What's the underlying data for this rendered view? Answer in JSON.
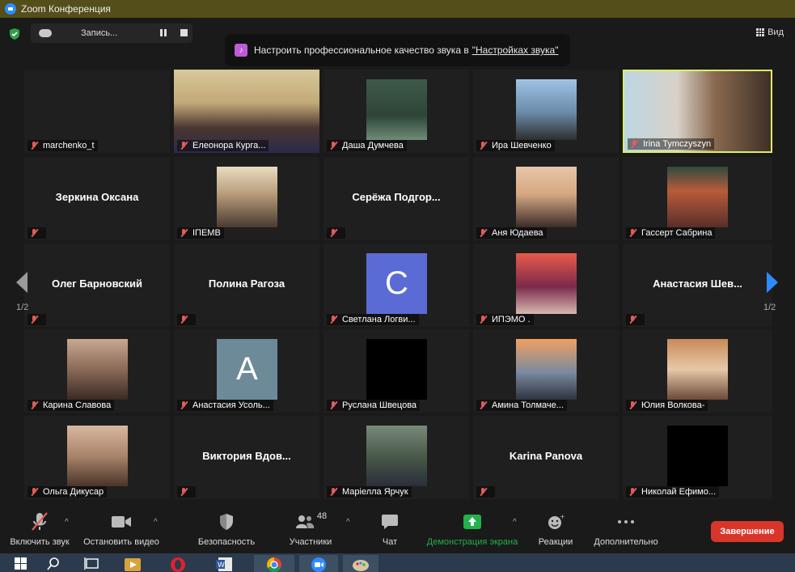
{
  "window": {
    "title": "Zoom Конференция"
  },
  "topbar": {
    "recording_label": "Запись...",
    "view_label": "Вид",
    "notice_text": "Настроить профессиональное качество звука в",
    "notice_link": "\"Настройках звука\""
  },
  "pagination": {
    "left": "1/2",
    "right": "1/2"
  },
  "tiles": [
    {
      "name": "marchenko_t",
      "type": "blank"
    },
    {
      "name": "Елеонора Курга...",
      "type": "video"
    },
    {
      "name": "Даша Думчева",
      "type": "photo"
    },
    {
      "name": "Ира Шевченко",
      "type": "photo"
    },
    {
      "name": "Irina Tymczyszyn",
      "type": "video",
      "active": true
    },
    {
      "name": "Зеркина Оксана",
      "type": "name"
    },
    {
      "name": "IПЕМВ",
      "type": "photo"
    },
    {
      "name": "Серёжа  Подгор...",
      "type": "name"
    },
    {
      "name": "Аня Юдаева",
      "type": "photo"
    },
    {
      "name": "Гассерт Сабрина",
      "type": "photo"
    },
    {
      "name": "Олег Барновский",
      "type": "name"
    },
    {
      "name": "Полина Рагоза",
      "type": "name"
    },
    {
      "name": "Светлана Логви...",
      "type": "letter",
      "letter": "С"
    },
    {
      "name": "ИПЭМО .",
      "type": "photo"
    },
    {
      "name": "Анастасия  Шев...",
      "type": "name"
    },
    {
      "name": "Карина Славова",
      "type": "photo"
    },
    {
      "name": "Анастасия Усоль...",
      "type": "letter",
      "letter": "A"
    },
    {
      "name": "Руслана Швецова",
      "type": "black"
    },
    {
      "name": "Амина Толмаче...",
      "type": "photo"
    },
    {
      "name": "Юлия Волкова-",
      "type": "photo"
    },
    {
      "name": "Ольга Дикусар",
      "type": "photo"
    },
    {
      "name": "Виктория  Вдов...",
      "type": "name"
    },
    {
      "name": "Марiелла Ярчук",
      "type": "photo"
    },
    {
      "name": "Karina Panova",
      "type": "name"
    },
    {
      "name": "Николай Ефимо...",
      "type": "black"
    }
  ],
  "toolbar": {
    "unmute": "Включить звук",
    "stop_video": "Остановить видео",
    "security": "Безопасность",
    "participants": "Участники",
    "participants_count": "48",
    "chat": "Чат",
    "share_screen": "Демонстрация экрана",
    "reactions": "Реакции",
    "more": "Дополнительно",
    "end": "Завершение"
  },
  "colors": {
    "share_green": "#22b14c",
    "end_red": "#d9362b",
    "active_border": "#d9ef6a",
    "muted_red": "#e35b5b"
  }
}
